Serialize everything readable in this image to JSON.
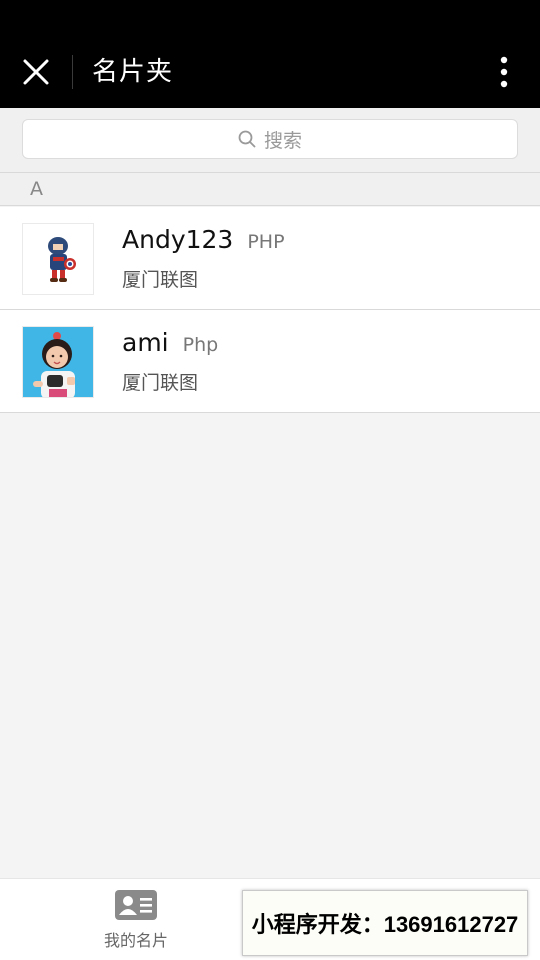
{
  "header": {
    "title": "名片夹",
    "close_icon": "close-icon",
    "more_icon": "more-vertical-icon"
  },
  "search": {
    "placeholder": "搜索",
    "icon": "search-icon"
  },
  "section": {
    "letter": "A"
  },
  "contacts": [
    {
      "name": "Andy123",
      "role": "PHP",
      "company": "厦门联图",
      "avatar": "captain-america-figure-avatar"
    },
    {
      "name": "ami",
      "role": "Php",
      "company": "厦门联图",
      "avatar": "child-photo-avatar"
    }
  ],
  "tabbar": {
    "my_card_label": "我的名片",
    "my_card_icon": "business-card-icon"
  },
  "promo": {
    "text": "小程序开发：13691612727"
  },
  "colors": {
    "header_bg": "#000000",
    "page_bg": "#f4f4f4",
    "avatar_bg_blue": "#3fb6e6"
  }
}
